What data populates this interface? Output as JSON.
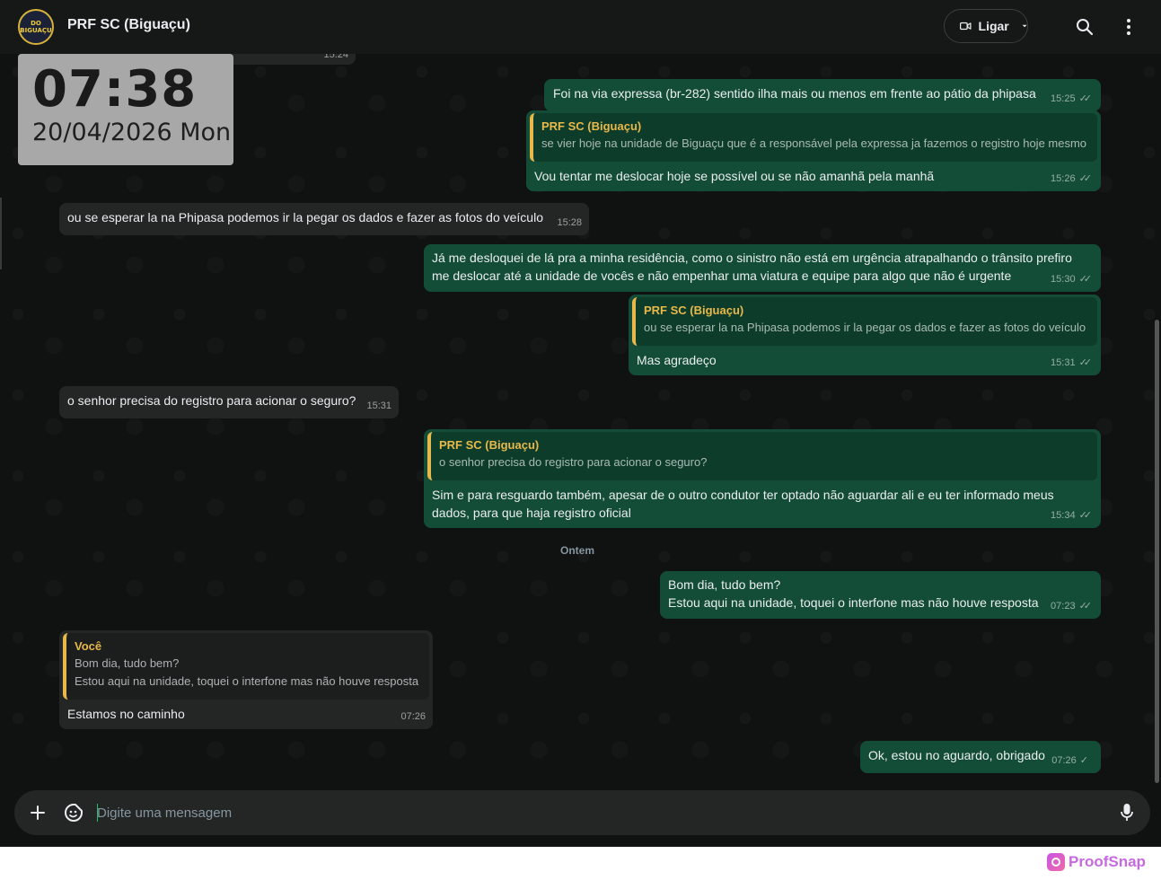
{
  "header": {
    "contact_name": "PRF SC (Biguaçu)",
    "avatar_text": [
      "DO",
      "BIGUAÇU"
    ],
    "call_label": "Ligar"
  },
  "clock_overlay": {
    "time": "07:38",
    "date": "20/04/2026 Mon"
  },
  "top_partial_time": "15:24",
  "date_separator": "Ontem",
  "messages": [
    {
      "dir": "out",
      "text": "Foi na via expressa (br-282) sentido ilha mais ou menos em frente ao pátio da phipasa",
      "time": "15:25",
      "status": "read"
    },
    {
      "dir": "out",
      "quote_author": "PRF SC (Biguaçu)",
      "quote_text": "se vier hoje na unidade de Biguaçu que é a responsável pela expressa ja fazemos o registro hoje mesmo",
      "text": "Vou tentar me deslocar hoje se possível ou se não amanhã pela manhã",
      "time": "15:26",
      "status": "read"
    },
    {
      "dir": "in",
      "text": "ou se esperar la na Phipasa podemos ir la pegar os dados e fazer as fotos do veículo",
      "time": "15:28"
    },
    {
      "dir": "out",
      "text_lines": [
        "Já me desloquei de lá pra a minha residência, como o sinistro não está em urgência atrapalhando o trânsito prefiro",
        "me deslocar até a unidade de vocês e não empenhar uma viatura e equipe para algo que não é urgente"
      ],
      "time": "15:30",
      "status": "read"
    },
    {
      "dir": "out",
      "quote_author": "PRF SC (Biguaçu)",
      "quote_text": "ou se esperar la na Phipasa podemos ir la pegar os dados e fazer as fotos do veículo",
      "text": "Mas agradeço",
      "time": "15:31",
      "status": "read"
    },
    {
      "dir": "in",
      "text": "o senhor precisa do registro para acionar o seguro?",
      "time": "15:31"
    },
    {
      "dir": "out",
      "quote_author": "PRF SC (Biguaçu)",
      "quote_text": "o senhor precisa do registro para acionar o seguro?",
      "text_lines": [
        "Sim e para resguardo também, apesar de o outro condutor ter optado não aguardar ali e eu ter informado meus",
        "dados, para que haja registro oficial"
      ],
      "time": "15:34",
      "status": "read"
    },
    {
      "dir": "out",
      "text_lines": [
        "Bom dia, tudo bem?",
        "Estou aqui na unidade, toquei o interfone mas não houve resposta"
      ],
      "time": "07:23",
      "status": "read"
    },
    {
      "dir": "in",
      "quote_author": "Você",
      "quote_lines": [
        "Bom dia, tudo bem?",
        "Estou aqui na unidade, toquei o interfone mas não houve resposta"
      ],
      "text": "Estamos no caminho",
      "time": "07:26"
    },
    {
      "dir": "out",
      "text": "Ok, estou no aguardo, obrigado",
      "time": "07:26",
      "status": "sent"
    }
  ],
  "composer": {
    "placeholder": "Digite uma mensagem"
  },
  "watermark": "ProofSnap",
  "colors": {
    "incoming_bubble": "#242626",
    "outgoing_bubble": "#144d37",
    "quote_accent": "#e8b84a",
    "background": "#101111"
  }
}
